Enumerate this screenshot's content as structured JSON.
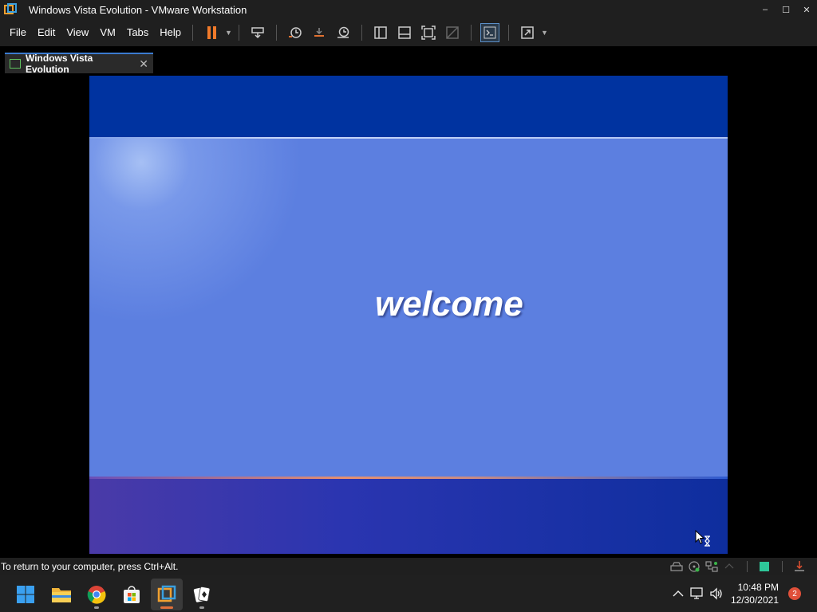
{
  "window": {
    "title": "Windows Vista Evolution - VMware Workstation",
    "controls": {
      "minimize": "–",
      "maximize": "☐",
      "close": "✕"
    }
  },
  "menu": {
    "items": [
      "File",
      "Edit",
      "View",
      "VM",
      "Tabs",
      "Help"
    ]
  },
  "toolbar": {
    "icons": [
      "pause-icon",
      "send-keys-icon",
      "snapshot-icon",
      "revert-snapshot-icon",
      "snapshot-manager-icon",
      "library-icon",
      "thumbnail-icon",
      "full-screen-icon",
      "unity-icon",
      "console-icon",
      "stretch-icon"
    ]
  },
  "tab": {
    "label": "Windows Vista Evolution",
    "close": "✕"
  },
  "vm": {
    "welcome_text": "welcome",
    "colors": {
      "top_band": "#0033a0",
      "middle": "#5c7fe0",
      "bottom": "#2a35b0"
    }
  },
  "status": {
    "message": "To return to your computer, press Ctrl+Alt."
  },
  "taskbar": {
    "apps": [
      "start-icon",
      "file-explorer-icon",
      "chrome-icon",
      "store-icon",
      "vmware-icon",
      "solitaire-icon"
    ],
    "active_app": "vmware-icon",
    "time": "10:48 PM",
    "date": "12/30/2021",
    "notifications": "2"
  }
}
